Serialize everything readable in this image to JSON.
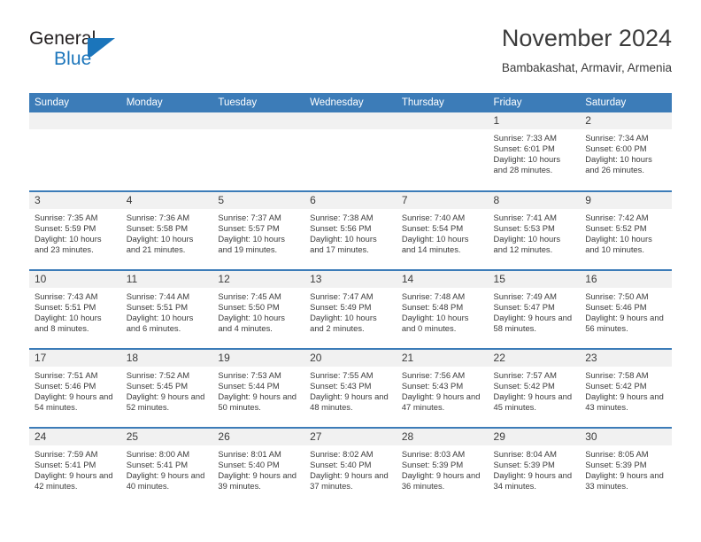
{
  "brand": {
    "name_part1": "General",
    "name_part2": "Blue",
    "logo_icon": "general-blue-flag-logo",
    "accent_color": "#1b75bb"
  },
  "header": {
    "title": "November 2024",
    "location": "Bambakashat, Armavir, Armenia"
  },
  "calendar": {
    "header_color": "#3c7cb8",
    "daynum_band_color": "#f1f1f1",
    "weekdays": [
      "Sunday",
      "Monday",
      "Tuesday",
      "Wednesday",
      "Thursday",
      "Friday",
      "Saturday"
    ],
    "weeks": [
      [
        {
          "day": "",
          "empty": true
        },
        {
          "day": "",
          "empty": true
        },
        {
          "day": "",
          "empty": true
        },
        {
          "day": "",
          "empty": true
        },
        {
          "day": "",
          "empty": true
        },
        {
          "day": "1",
          "sunrise": "Sunrise: 7:33 AM",
          "sunset": "Sunset: 6:01 PM",
          "daylight": "Daylight: 10 hours and 28 minutes."
        },
        {
          "day": "2",
          "sunrise": "Sunrise: 7:34 AM",
          "sunset": "Sunset: 6:00 PM",
          "daylight": "Daylight: 10 hours and 26 minutes."
        }
      ],
      [
        {
          "day": "3",
          "sunrise": "Sunrise: 7:35 AM",
          "sunset": "Sunset: 5:59 PM",
          "daylight": "Daylight: 10 hours and 23 minutes."
        },
        {
          "day": "4",
          "sunrise": "Sunrise: 7:36 AM",
          "sunset": "Sunset: 5:58 PM",
          "daylight": "Daylight: 10 hours and 21 minutes."
        },
        {
          "day": "5",
          "sunrise": "Sunrise: 7:37 AM",
          "sunset": "Sunset: 5:57 PM",
          "daylight": "Daylight: 10 hours and 19 minutes."
        },
        {
          "day": "6",
          "sunrise": "Sunrise: 7:38 AM",
          "sunset": "Sunset: 5:56 PM",
          "daylight": "Daylight: 10 hours and 17 minutes."
        },
        {
          "day": "7",
          "sunrise": "Sunrise: 7:40 AM",
          "sunset": "Sunset: 5:54 PM",
          "daylight": "Daylight: 10 hours and 14 minutes."
        },
        {
          "day": "8",
          "sunrise": "Sunrise: 7:41 AM",
          "sunset": "Sunset: 5:53 PM",
          "daylight": "Daylight: 10 hours and 12 minutes."
        },
        {
          "day": "9",
          "sunrise": "Sunrise: 7:42 AM",
          "sunset": "Sunset: 5:52 PM",
          "daylight": "Daylight: 10 hours and 10 minutes."
        }
      ],
      [
        {
          "day": "10",
          "sunrise": "Sunrise: 7:43 AM",
          "sunset": "Sunset: 5:51 PM",
          "daylight": "Daylight: 10 hours and 8 minutes."
        },
        {
          "day": "11",
          "sunrise": "Sunrise: 7:44 AM",
          "sunset": "Sunset: 5:51 PM",
          "daylight": "Daylight: 10 hours and 6 minutes."
        },
        {
          "day": "12",
          "sunrise": "Sunrise: 7:45 AM",
          "sunset": "Sunset: 5:50 PM",
          "daylight": "Daylight: 10 hours and 4 minutes."
        },
        {
          "day": "13",
          "sunrise": "Sunrise: 7:47 AM",
          "sunset": "Sunset: 5:49 PM",
          "daylight": "Daylight: 10 hours and 2 minutes."
        },
        {
          "day": "14",
          "sunrise": "Sunrise: 7:48 AM",
          "sunset": "Sunset: 5:48 PM",
          "daylight": "Daylight: 10 hours and 0 minutes."
        },
        {
          "day": "15",
          "sunrise": "Sunrise: 7:49 AM",
          "sunset": "Sunset: 5:47 PM",
          "daylight": "Daylight: 9 hours and 58 minutes."
        },
        {
          "day": "16",
          "sunrise": "Sunrise: 7:50 AM",
          "sunset": "Sunset: 5:46 PM",
          "daylight": "Daylight: 9 hours and 56 minutes."
        }
      ],
      [
        {
          "day": "17",
          "sunrise": "Sunrise: 7:51 AM",
          "sunset": "Sunset: 5:46 PM",
          "daylight": "Daylight: 9 hours and 54 minutes."
        },
        {
          "day": "18",
          "sunrise": "Sunrise: 7:52 AM",
          "sunset": "Sunset: 5:45 PM",
          "daylight": "Daylight: 9 hours and 52 minutes."
        },
        {
          "day": "19",
          "sunrise": "Sunrise: 7:53 AM",
          "sunset": "Sunset: 5:44 PM",
          "daylight": "Daylight: 9 hours and 50 minutes."
        },
        {
          "day": "20",
          "sunrise": "Sunrise: 7:55 AM",
          "sunset": "Sunset: 5:43 PM",
          "daylight": "Daylight: 9 hours and 48 minutes."
        },
        {
          "day": "21",
          "sunrise": "Sunrise: 7:56 AM",
          "sunset": "Sunset: 5:43 PM",
          "daylight": "Daylight: 9 hours and 47 minutes."
        },
        {
          "day": "22",
          "sunrise": "Sunrise: 7:57 AM",
          "sunset": "Sunset: 5:42 PM",
          "daylight": "Daylight: 9 hours and 45 minutes."
        },
        {
          "day": "23",
          "sunrise": "Sunrise: 7:58 AM",
          "sunset": "Sunset: 5:42 PM",
          "daylight": "Daylight: 9 hours and 43 minutes."
        }
      ],
      [
        {
          "day": "24",
          "sunrise": "Sunrise: 7:59 AM",
          "sunset": "Sunset: 5:41 PM",
          "daylight": "Daylight: 9 hours and 42 minutes."
        },
        {
          "day": "25",
          "sunrise": "Sunrise: 8:00 AM",
          "sunset": "Sunset: 5:41 PM",
          "daylight": "Daylight: 9 hours and 40 minutes."
        },
        {
          "day": "26",
          "sunrise": "Sunrise: 8:01 AM",
          "sunset": "Sunset: 5:40 PM",
          "daylight": "Daylight: 9 hours and 39 minutes."
        },
        {
          "day": "27",
          "sunrise": "Sunrise: 8:02 AM",
          "sunset": "Sunset: 5:40 PM",
          "daylight": "Daylight: 9 hours and 37 minutes."
        },
        {
          "day": "28",
          "sunrise": "Sunrise: 8:03 AM",
          "sunset": "Sunset: 5:39 PM",
          "daylight": "Daylight: 9 hours and 36 minutes."
        },
        {
          "day": "29",
          "sunrise": "Sunrise: 8:04 AM",
          "sunset": "Sunset: 5:39 PM",
          "daylight": "Daylight: 9 hours and 34 minutes."
        },
        {
          "day": "30",
          "sunrise": "Sunrise: 8:05 AM",
          "sunset": "Sunset: 5:39 PM",
          "daylight": "Daylight: 9 hours and 33 minutes."
        }
      ]
    ]
  }
}
